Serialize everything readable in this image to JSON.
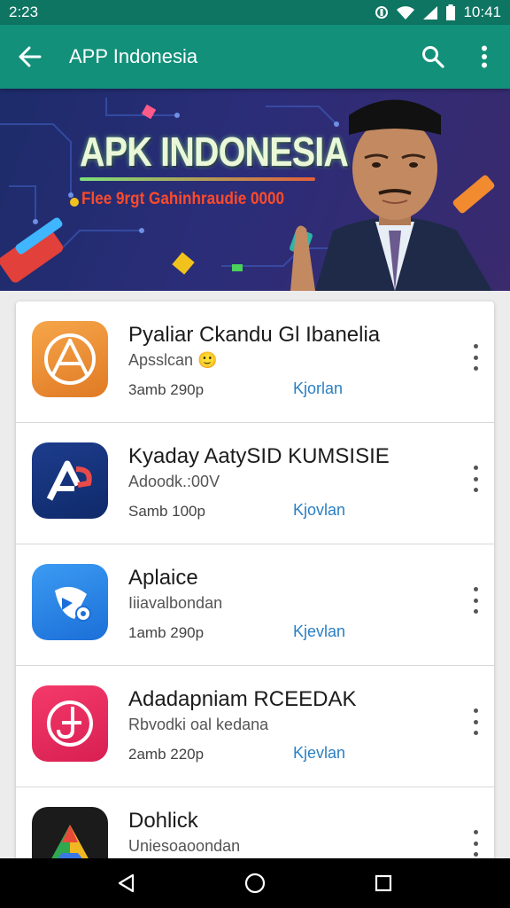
{
  "status_bar": {
    "time": "2:23",
    "battery": "10:41"
  },
  "app_bar": {
    "title": "APP Indonesia"
  },
  "banner": {
    "title": "APK INDONESIA",
    "subtitle": "Flee 9rgt Gahinhraudie 0000"
  },
  "apps": [
    {
      "name": "Pyaliar Ckandu Gl Ibanelia",
      "developer": "Apsslcan",
      "emoji": "🙂",
      "size": "3amb 290p",
      "action": "Kjorlan"
    },
    {
      "name": "Kyaday AatySID KUMSISIE",
      "developer": "Adoodk.:00V",
      "size": "Samb 100p",
      "action": "Kjovlan"
    },
    {
      "name": "Aplaice",
      "developer": "Iiiavalbondan",
      "size": "1amb 290p",
      "action": "Kjevlan"
    },
    {
      "name": "Adadapniam RCEEDAK",
      "developer": "Rbvodki oal kedana",
      "size": "2amb 220p",
      "action": "Kjevlan"
    },
    {
      "name": "Dohlick",
      "developer": "Uniesoaoondan",
      "size": "",
      "action": ""
    }
  ],
  "colors": {
    "status_bar": "#0f7563",
    "app_bar": "#12907a",
    "install_link": "#2a7fc4"
  },
  "icons": {
    "app_bar": [
      "arrow-back-icon",
      "search-icon",
      "more-vert-icon"
    ],
    "nav": [
      "back-triangle-icon",
      "home-circle-icon",
      "recents-square-icon"
    ]
  }
}
